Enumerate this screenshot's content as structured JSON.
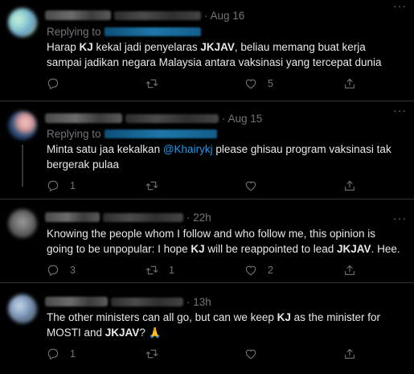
{
  "tweets": [
    {
      "time": "· Aug 16",
      "replying_label": "Replying to",
      "text_parts": [
        "Harap ",
        "KJ",
        " kekal jadi penyelaras ",
        "JKJAV",
        ", beliau memang buat kerja sampai jadikan negara Malaysia antara vaksinasi yang tercepat dunia"
      ],
      "reply_count": "",
      "retweet_count": "",
      "like_count": "5"
    },
    {
      "time": "· Aug 15",
      "replying_label": "Replying to",
      "text_parts": [
        "Minta satu jaa kekalkan ",
        "@Khairykj",
        " please ghisau program vaksinasi tak bergerak pulaa"
      ],
      "reply_count": "1",
      "retweet_count": "",
      "like_count": ""
    },
    {
      "time": "· 22h",
      "text_parts": [
        "Knowing the people whom I follow and who follow me, this opinion is going to be unpopular: I hope ",
        "KJ",
        " will be reappointed to lead ",
        "JKJAV",
        ". Hee."
      ],
      "reply_count": "3",
      "retweet_count": "1",
      "like_count": "2"
    },
    {
      "time": "· 13h",
      "text_parts": [
        "The other ministers can all go, but can we keep ",
        "KJ",
        " as the minister for MOSTI and ",
        "JKJAV",
        "? ",
        "🙏"
      ],
      "reply_count": "1",
      "retweet_count": "",
      "like_count": ""
    }
  ],
  "more_label": "···",
  "icons": [
    "reply-icon",
    "retweet-icon",
    "like-icon",
    "share-icon"
  ],
  "colors": {
    "background": "#000000",
    "text": "#e7e9ea",
    "muted": "#71767b",
    "link": "#1d9bf0",
    "divider": "#2f3336"
  }
}
